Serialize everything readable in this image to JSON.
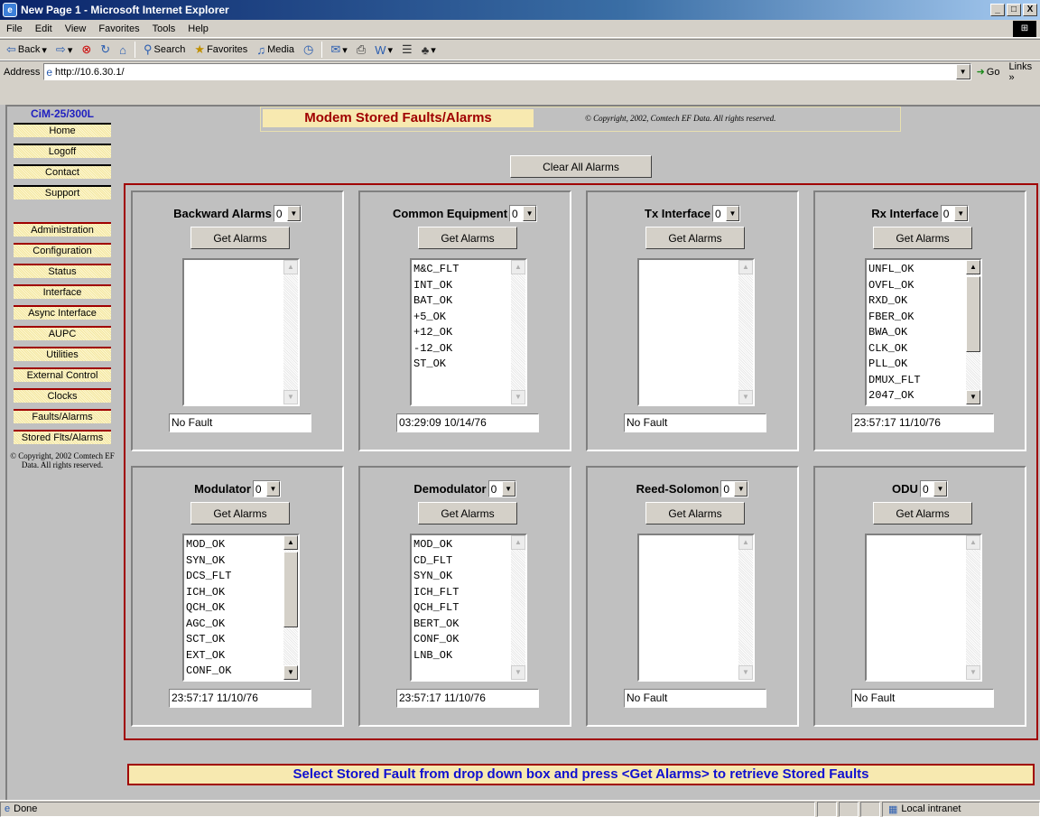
{
  "window": {
    "title": "New Page 1 - Microsoft Internet Explorer",
    "minimize": "_",
    "maximize": "□",
    "close": "X"
  },
  "menu": [
    "File",
    "Edit",
    "View",
    "Favorites",
    "Tools",
    "Help"
  ],
  "toolbar": {
    "back": "Back",
    "search": "Search",
    "favorites": "Favorites",
    "media": "Media"
  },
  "address": {
    "label": "Address",
    "url": "http://10.6.30.1/",
    "go": "Go",
    "links": "Links"
  },
  "sidebar": {
    "product": "CiM-25/300L",
    "top_items": [
      "Home",
      "Logoff",
      "Contact",
      "Support"
    ],
    "items": [
      "Administration",
      "Configuration",
      "Status",
      "Interface",
      "Async Interface",
      "AUPC",
      "Utilities",
      "External Control",
      "Clocks",
      "Faults/Alarms",
      "Stored Flts/Alarms"
    ],
    "copyright": "© Copyright, 2002 Comtech EF Data. All rights reserved."
  },
  "header": {
    "title": "Modem Stored Faults/Alarms",
    "copyright": "© Copyright, 2002, Comtech EF Data. All rights reserved."
  },
  "clear_all": "Clear All Alarms",
  "get_alarms": "Get Alarms",
  "panels": [
    {
      "title": "Backward Alarms",
      "select": "0",
      "items": [],
      "result": "No Fault"
    },
    {
      "title": "Common Equipment",
      "select": "0",
      "items": [
        "M&C_FLT",
        "INT_OK",
        "BAT_OK",
        "+5_OK",
        "+12_OK",
        "-12_OK",
        "ST_OK"
      ],
      "result": "03:29:09 10/14/76"
    },
    {
      "title": "Tx Interface",
      "select": "0",
      "items": [],
      "result": "No Fault"
    },
    {
      "title": "Rx Interface",
      "select": "0",
      "items": [
        "UNFL_OK",
        "OVFL_OK",
        "RXD_OK",
        "FBER_OK",
        "BWA_OK",
        "CLK_OK",
        "PLL_OK",
        "DMUX_FLT",
        "2047_OK"
      ],
      "result": "23:57:17 11/10/76"
    },
    {
      "title": "Modulator",
      "select": "0",
      "items": [
        "MOD_OK",
        "SYN_OK",
        "DCS_FLT",
        "ICH_OK",
        "QCH_OK",
        "AGC_OK",
        "SCT_OK",
        "EXT_OK",
        "CONF_OK"
      ],
      "result": "23:57:17 11/10/76"
    },
    {
      "title": "Demodulator",
      "select": "0",
      "items": [
        "MOD_OK",
        "CD_FLT",
        "SYN_OK",
        "ICH_FLT",
        "QCH_FLT",
        "BERT_OK",
        "CONF_OK",
        "LNB_OK"
      ],
      "result": "23:57:17 11/10/76"
    },
    {
      "title": "Reed-Solomon",
      "select": "0",
      "items": [],
      "result": "No Fault"
    },
    {
      "title": "ODU",
      "select": "0",
      "items": [],
      "result": "No Fault"
    }
  ],
  "instruction": "Select Stored Fault from drop down box and press <Get Alarms> to retrieve Stored Faults",
  "status": {
    "text": "Done",
    "zone": "Local intranet"
  }
}
